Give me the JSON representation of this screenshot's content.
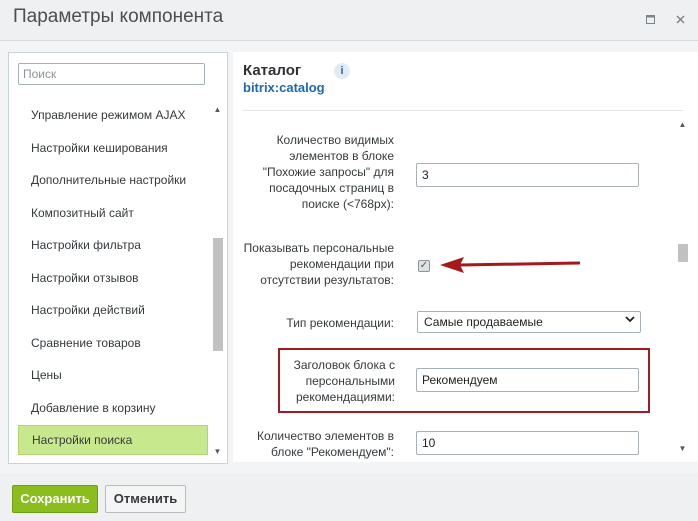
{
  "dialog": {
    "title": "Параметры компонента",
    "icons": [
      "maximize-icon",
      "close-icon"
    ]
  },
  "sidebar": {
    "search_placeholder": "Поиск",
    "items": [
      {
        "label": "Управление режимом AJAX"
      },
      {
        "label": "Настройки кеширования"
      },
      {
        "label": "Дополнительные настройки"
      },
      {
        "label": "Композитный сайт"
      },
      {
        "label": "Настройки фильтра"
      },
      {
        "label": "Настройки отзывов"
      },
      {
        "label": "Настройки действий"
      },
      {
        "label": "Сравнение товаров"
      },
      {
        "label": "Цены"
      },
      {
        "label": "Добавление в корзину"
      },
      {
        "label": "Настройки поиска",
        "active": true
      }
    ]
  },
  "main": {
    "title": "Каталог",
    "subtitle": "bitrix:catalog",
    "fields": {
      "similar_queries_label": "Количество видимых элементов в блоке \"Похожие запросы\" для посадочных страниц в поиске (<768px):",
      "similar_queries_value": "3",
      "show_personal_label": "Показывать персональные рекомендации при отсутствии результатов:",
      "show_personal_checked": true,
      "rec_type_label": "Тип рекомендации:",
      "rec_type_value": "Самые продаваемые",
      "block_title_label": "Заголовок блока с персональными рекомендациями:",
      "block_title_value": "Рекомендуем",
      "rec_count_label": "Количество элементов в блоке \"Рекомендуем\":",
      "rec_count_value": "10"
    }
  },
  "footer": {
    "save_label": "Сохранить",
    "cancel_label": "Отменить"
  },
  "colors": {
    "accent_green": "#8bbd1f",
    "active_item": "#c8e88e",
    "link_blue": "#2067b0",
    "annotation_red": "#9e1c1f"
  }
}
